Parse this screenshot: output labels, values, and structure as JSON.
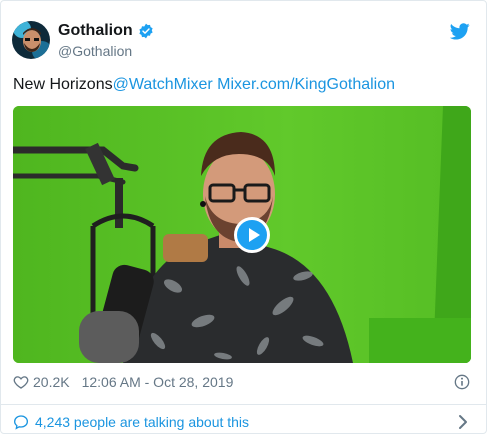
{
  "header": {
    "name": "Gothalion",
    "handle": "@Gothalion"
  },
  "tweet": {
    "text": "New Horizons",
    "mention": "@WatchMixer",
    "link": "Mixer.com/KingGothalion"
  },
  "footer": {
    "likes": "20.2K",
    "timestamp": "12:06 AM - Oct 28, 2019",
    "talking": "4,243 people are talking about this"
  },
  "colors": {
    "link": "#1b95e0",
    "muted": "#657786",
    "twitter_blue": "#1da1f2",
    "green_screen": "#59c227"
  },
  "icons": [
    "verified-badge-icon",
    "twitter-bird-icon",
    "play-icon",
    "heart-icon",
    "info-icon",
    "speech-bubble-icon",
    "chevron-right-icon"
  ]
}
